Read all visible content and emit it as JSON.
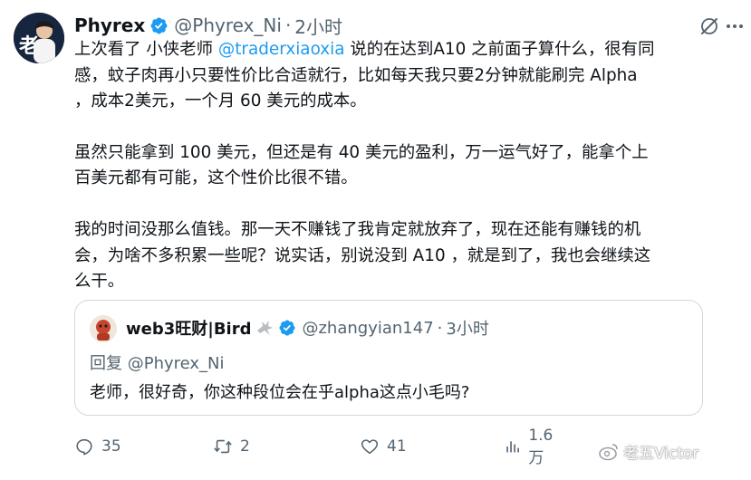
{
  "tweet": {
    "author_name": "Phyrex",
    "author_handle": "@Phyrex_Ni",
    "separator": "·",
    "time": "2小时",
    "avatar_text": "老",
    "body": {
      "line1_prefix": "上次看了 小侠老师 ",
      "mention": "@traderxiaoxia",
      "line1_suffix": " 说的在达到A10 之前面子算什么，很有同",
      "line2": "感，蚊子肉再小只要性价比合适就行，比如每天我只要2分钟就能刷完 Alpha",
      "line3": "，成本2美元，一个月 60 美元的成本。",
      "line4": "虽然只能拿到 100 美元，但还是有 40 美元的盈利，万一运气好了，能拿个上",
      "line5": "百美元都有可能，这个性价比很不错。",
      "line6": "我的时间没那么值钱。那一天不赚钱了我肯定就放弃了，现在还能有赚钱的机",
      "line7": "会，为啥不多积累一些呢？说实话，别说没到 A10 ，就是到了，我也会继续这",
      "line8": "么干。"
    }
  },
  "quote": {
    "author_name": "web3旺财|Bird",
    "author_handle": "@zhangyian147",
    "separator": "·",
    "time": "3小时",
    "reply_to": "回复 @Phyrex_Ni",
    "text": "老师，很好奇，你这种段位会在乎alpha这点小毛吗?"
  },
  "actions": {
    "replies": "35",
    "retweets": "2",
    "likes": "41",
    "views": "1.6万"
  },
  "watermark": "老五Victor",
  "colors": {
    "text": "#0f1419",
    "secondary": "#536471",
    "link": "#1d9bf0",
    "border": "#cfd9de",
    "verified": "#1d9bf0"
  }
}
